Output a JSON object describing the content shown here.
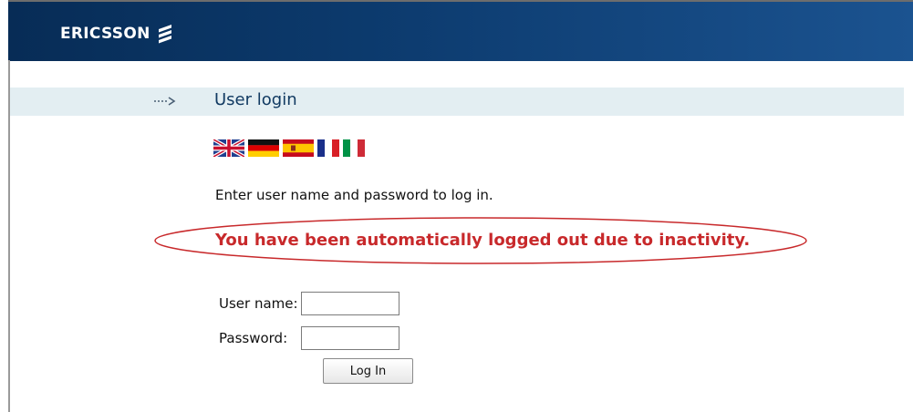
{
  "header": {
    "logo_text": "ERICSSON",
    "logo_icon": "ericsson-logo-icon",
    "background_color": "#0d3c70"
  },
  "section": {
    "title": "User login",
    "arrow_icon": "dotted-arrow-icon"
  },
  "languages": [
    {
      "name": "flag-uk-icon"
    },
    {
      "name": "flag-germany-icon"
    },
    {
      "name": "flag-spain-icon"
    },
    {
      "name": "flag-france-icon"
    },
    {
      "name": "flag-italy-icon"
    }
  ],
  "instruction": "Enter user name and password to log in.",
  "message": {
    "text": "You have been automatically logged out due to inactivity.",
    "color": "#c8292b"
  },
  "form": {
    "username_label": "User name:",
    "username_value": "",
    "password_label": "Password:",
    "password_value": "",
    "login_button": "Log In"
  }
}
